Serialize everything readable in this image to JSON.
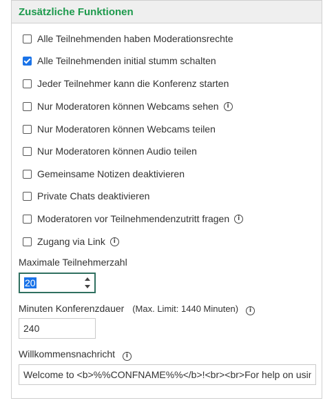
{
  "panel": {
    "title": "Zusätzliche Funktionen",
    "title_color": "#1e9a4d"
  },
  "options": [
    {
      "label": "Alle Teilnehmenden haben Moderationsrechte",
      "checked": false,
      "info": false
    },
    {
      "label": "Alle Teilnehmenden initial stumm schalten",
      "checked": true,
      "info": false
    },
    {
      "label": "Jeder Teilnehmer kann die Konferenz starten",
      "checked": false,
      "info": false
    },
    {
      "label": "Nur Moderatoren können Webcams sehen",
      "checked": false,
      "info": true
    },
    {
      "label": "Nur Moderatoren können Webcams teilen",
      "checked": false,
      "info": false
    },
    {
      "label": "Nur Moderatoren können Audio teilen",
      "checked": false,
      "info": false
    },
    {
      "label": "Gemeinsame Notizen deaktivieren",
      "checked": false,
      "info": false
    },
    {
      "label": "Private Chats deaktivieren",
      "checked": false,
      "info": false
    },
    {
      "label": "Moderatoren vor Teilnehmendenzutritt fragen",
      "checked": false,
      "info": true
    },
    {
      "label": "Zugang via Link",
      "checked": false,
      "info": true
    }
  ],
  "max_participants": {
    "label": "Maximale Teilnehmerzahl",
    "value": "20"
  },
  "duration": {
    "label": "Minuten Konferenzdauer",
    "hint": "(Max. Limit: 1440 Minuten)",
    "value": "240"
  },
  "welcome": {
    "label": "Willkommensnachricht",
    "value": "Welcome to <b>%%CONFNAME%%</b>!<br><br>For help on using"
  },
  "info_symbol": "i"
}
